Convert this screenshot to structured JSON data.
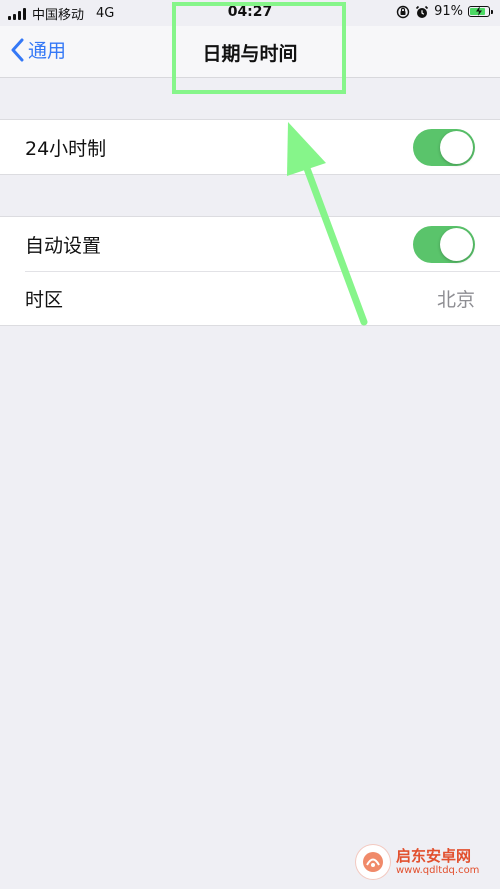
{
  "status_bar": {
    "carrier": "中国移动",
    "network": "4G",
    "time": "04:27",
    "battery_percent": "91%",
    "battery_level": 0.91,
    "icons": [
      "signal-icon",
      "orientation-lock-icon",
      "alarm-icon",
      "battery-charging-icon"
    ]
  },
  "nav": {
    "back_label": "通用",
    "title": "日期与时间"
  },
  "settings": {
    "group1": {
      "row1": {
        "label": "24小时制",
        "toggle_on": true
      }
    },
    "group2": {
      "row1": {
        "label": "自动设置",
        "toggle_on": true
      },
      "row2": {
        "label": "时区",
        "value": "北京"
      }
    }
  },
  "colors": {
    "accent": "#3478f6",
    "toggle_on": "#5ac46b",
    "background": "#efeff4",
    "annotation": "#86f58a",
    "watermark": "#e2502e"
  },
  "watermark": {
    "main": "启东安卓网",
    "sub": "www.qdltdq.com"
  }
}
